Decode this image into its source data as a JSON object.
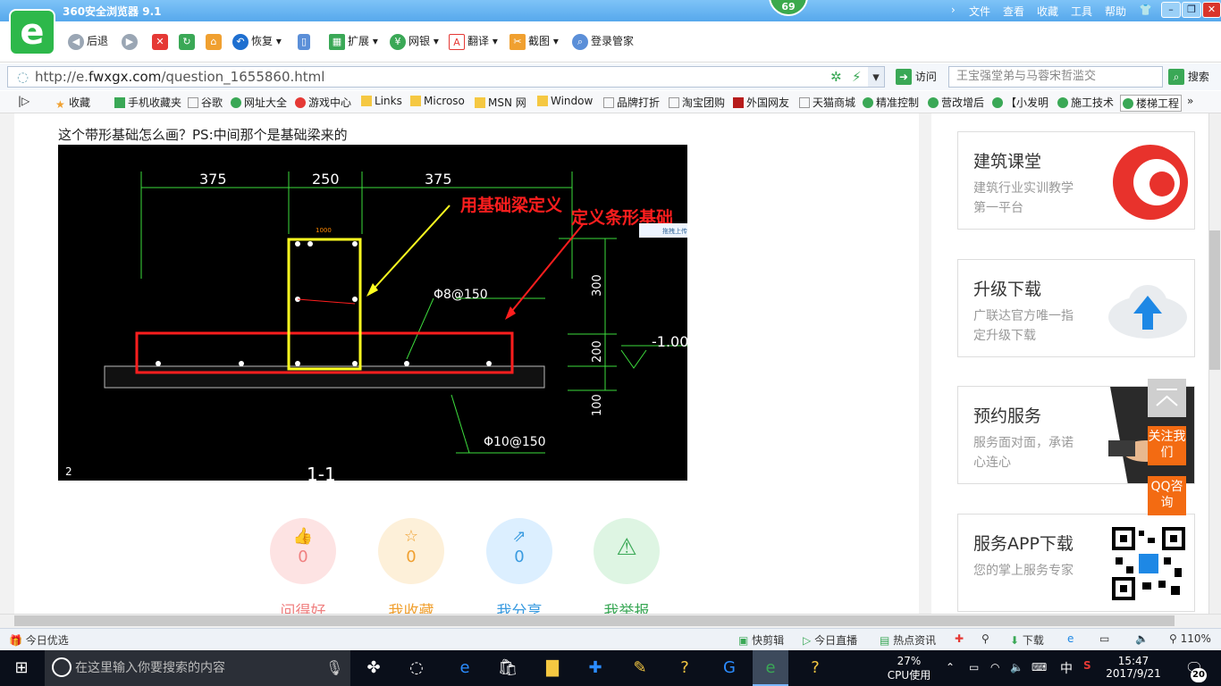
{
  "window": {
    "title": "360安全浏览器 9.1",
    "menu": [
      "文件",
      "查看",
      "收藏",
      "工具",
      "帮助"
    ],
    "badge": "69"
  },
  "toolbar": {
    "back": "后退",
    "restore": "恢复",
    "extend": "扩展",
    "netbank": "网银",
    "translate": "翻译",
    "screenshot": "截图",
    "login": "登录管家"
  },
  "address": {
    "prefix": "http://e.",
    "domain": "fwxgx.com",
    "path": "/question_1655860.html",
    "go": "访问",
    "search_placeholder": "王宝强堂弟与马蓉宋哲滥交",
    "search_btn": "搜索"
  },
  "favorites": [
    "收藏",
    "手机收藏夹",
    "谷歌",
    "网址大全",
    "游戏中心",
    "Links",
    "Microso",
    "MSN 网",
    "Window",
    "品牌打折",
    "淘宝团购",
    "外国网友",
    "天猫商城",
    "精准控制",
    "营改增后",
    "【小发明",
    "施工技术",
    "楼梯工程"
  ],
  "question": {
    "text": "这个带形基础怎么画？PS:中间那个是基础梁来的"
  },
  "drawing": {
    "dims_top": [
      "375",
      "250",
      "375"
    ],
    "small_dim": "1000",
    "beam_label": "用基础梁定义",
    "strip_label": "定义条形基础",
    "rebar1": "Φ8@150",
    "rebar2": "Φ10@150",
    "right_dims": [
      "300",
      "200",
      "100"
    ],
    "elevation": "-1.00",
    "section": "1-1",
    "corner": "2",
    "chip": "拖拽上传"
  },
  "actions": [
    {
      "label": "问得好",
      "count": "0",
      "color": "#f08080",
      "bg": "#fde3e3"
    },
    {
      "label": "我收藏",
      "count": "0",
      "color": "#f0a030",
      "bg": "#fdf0d9"
    },
    {
      "label": "我分享",
      "count": "0",
      "color": "#3a9be0",
      "bg": "#dcefff"
    },
    {
      "label": "我举报",
      "count": "",
      "color": "#3aa856",
      "bg": "#def5e3"
    }
  ],
  "sidebar": {
    "cards": [
      {
        "title": "建筑课堂",
        "sub": "建筑行业实训教学第一平台"
      },
      {
        "title": "升级下载",
        "sub": "广联达官方唯一指定升级下载"
      },
      {
        "title": "预约服务",
        "sub": "服务面对面，承诺心连心"
      },
      {
        "title": "服务APP下载",
        "sub": "您的掌上服务专家"
      }
    ],
    "follow": "关注我们",
    "qq": "QQ咨询"
  },
  "statusbar": {
    "left": "今日优选",
    "items": [
      "快剪辑",
      "今日直播",
      "热点资讯",
      "下载"
    ],
    "zoom": "110%"
  },
  "taskbar": {
    "search_placeholder": "在这里输入你要搜索的内容",
    "cpu_percent": "27%",
    "cpu_label": "CPU使用",
    "ime": "中",
    "time": "15:47",
    "date": "2017/9/21",
    "notifications": "20"
  }
}
